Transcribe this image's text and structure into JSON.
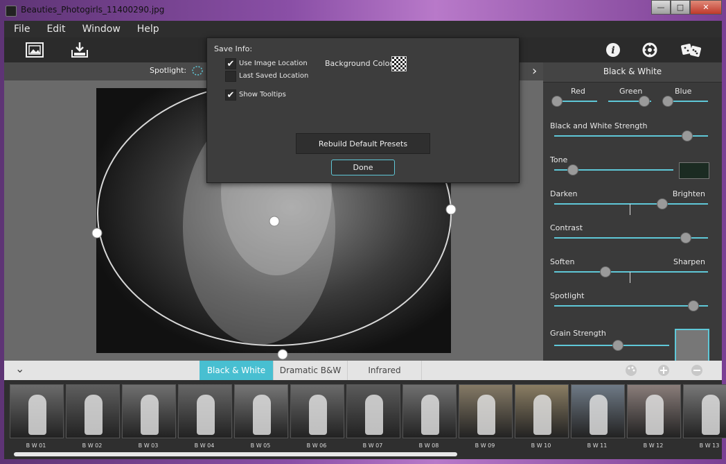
{
  "window": {
    "title": "Beauties_Photogirls_11400290.jpg",
    "controls": {
      "minimize": "—",
      "maximize": "□",
      "close": "✕"
    }
  },
  "menu": [
    "File",
    "Edit",
    "Window",
    "Help"
  ],
  "toolbar": {
    "left_icons": [
      "open-image-icon",
      "save-icon"
    ],
    "right_icons": [
      "info-icon",
      "settings-icon",
      "random-dice-icon"
    ]
  },
  "options_bar": {
    "spotlight_label": "Spotlight:"
  },
  "dialog": {
    "heading": "Save Info:",
    "use_image_location": {
      "label": "Use Image Location",
      "checked": true
    },
    "last_saved_location": {
      "label": "Last Saved Location",
      "checked": false
    },
    "show_tooltips": {
      "label": "Show Tooltips",
      "checked": true
    },
    "background_color_label": "Background Color",
    "rebuild_label": "Rebuild Default Presets",
    "done_label": "Done"
  },
  "panel": {
    "title": "Black & White",
    "collapse_glyph": "›",
    "channels": {
      "red": "Red",
      "green": "Green",
      "blue": "Blue"
    },
    "labels": {
      "bw_strength": "Black and White Strength",
      "tone": "Tone",
      "darken": "Darken",
      "brighten": "Brighten",
      "contrast": "Contrast",
      "soften": "Soften",
      "sharpen": "Sharpen",
      "spotlight": "Spotlight",
      "grain": "Grain Strength"
    },
    "levels": {
      "red": 0.05,
      "green": 0.82,
      "blue": 0.1,
      "bw_strength": 0.86,
      "tone": 0.15,
      "darken_brighten": 0.7,
      "contrast": 0.85,
      "soften_sharpen": 0.33,
      "spotlight": 0.9,
      "grain": 0.55
    },
    "tone_swatch_color": "#1b2b22"
  },
  "presets": {
    "tabs": [
      "Black & White",
      "Dramatic B&W",
      "Infrared"
    ],
    "active_tab": "Black & White",
    "expand_glyph": "⌄",
    "thumbnails": [
      "B W 01",
      "B W 02",
      "B W 03",
      "B W 04",
      "B W 05",
      "B W 06",
      "B W 07",
      "B W 08",
      "B W 09",
      "B W 10",
      "B W 11",
      "B W 12",
      "B W 13"
    ],
    "actions": [
      "palette-icon",
      "add-preset-icon",
      "remove-preset-icon"
    ]
  },
  "colors": {
    "accent": "#48bfd1",
    "panel_bg": "#3a3a3a",
    "dark_bg": "#2b2b2b"
  }
}
